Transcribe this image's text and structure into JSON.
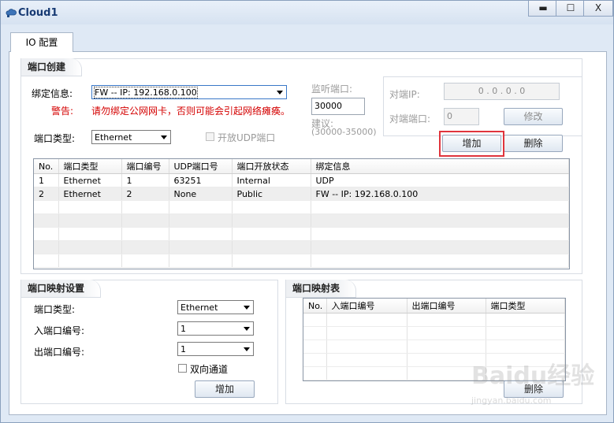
{
  "window": {
    "title": "Cloud1",
    "minimize_label": "▬",
    "maximize_label": "☐",
    "close_label": "X"
  },
  "tabs": [
    {
      "label": "IO 配置"
    }
  ],
  "port_create": {
    "title": "端口创建",
    "bind_label": "绑定信息:",
    "bind_value": "FW -- IP: 192.168.0.100",
    "warning_label": "警告:",
    "warning_text": "请勿绑定公网网卡，否则可能会引起网络瘫痪。",
    "port_type_label": "端口类型:",
    "port_type_value": "Ethernet",
    "udp_open_label": "开放UDP端口",
    "listen_label": "监听端口:",
    "listen_value": "30000",
    "suggest_label": "建议:",
    "suggest_range": "(30000-35000)",
    "peer_ip_label": "对端IP:",
    "peer_ip_value": "0 . 0 . 0 . 0",
    "peer_port_label": "对端端口:",
    "peer_port_value": "0",
    "modify_button": "修改",
    "add_button": "增加",
    "delete_button": "删除",
    "columns": [
      "No.",
      "端口类型",
      "端口编号",
      "UDP端口号",
      "端口开放状态",
      "绑定信息"
    ],
    "rows": [
      [
        "1",
        "Ethernet",
        "1",
        "63251",
        "Internal",
        "UDP"
      ],
      [
        "2",
        "Ethernet",
        "2",
        "None",
        "Public",
        "FW -- IP: 192.168.0.100"
      ]
    ]
  },
  "port_map_settings": {
    "title": "端口映射设置",
    "port_type_label": "端口类型:",
    "port_type_value": "Ethernet",
    "in_port_label": "入端口编号:",
    "in_port_value": "1",
    "out_port_label": "出端口编号:",
    "out_port_value": "1",
    "bidirectional_label": "双向通道",
    "add_button": "增加"
  },
  "port_map_table": {
    "title": "端口映射表",
    "columns": [
      "No.",
      "入端口编号",
      "出端口编号",
      "端口类型"
    ],
    "delete_button": "删除"
  },
  "watermark": {
    "text": "Baidu经验",
    "sub": "jingyan.baidu.com"
  }
}
